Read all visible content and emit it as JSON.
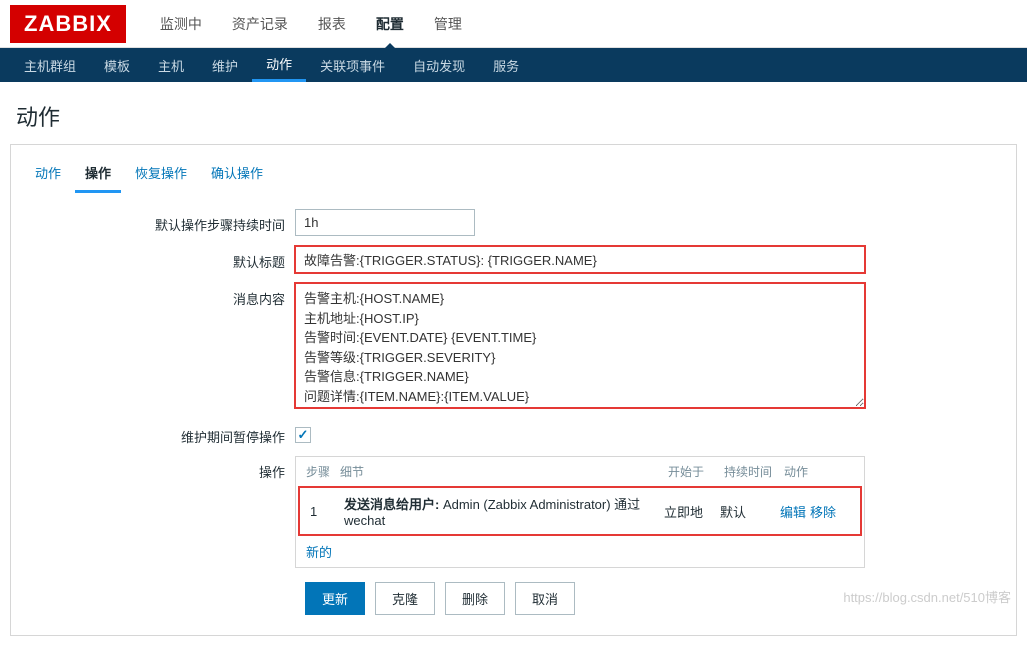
{
  "logo": "ZABBIX",
  "topNav": {
    "items": [
      "监测中",
      "资产记录",
      "报表",
      "配置",
      "管理"
    ],
    "activeIndex": 3
  },
  "subNav": {
    "items": [
      "主机群组",
      "模板",
      "主机",
      "维护",
      "动作",
      "关联项事件",
      "自动发现",
      "服务"
    ],
    "activeIndex": 4
  },
  "pageTitle": "动作",
  "innerTabs": {
    "items": [
      "动作",
      "操作",
      "恢复操作",
      "确认操作"
    ],
    "activeIndex": 1
  },
  "form": {
    "durationLabel": "默认操作步骤持续时间",
    "durationValue": "1h",
    "titleLabel": "默认标题",
    "titleValue": "故障告警:{TRIGGER.STATUS}: {TRIGGER.NAME}",
    "messageLabel": "消息内容",
    "messageValue": "告警主机:{HOST.NAME}\n主机地址:{HOST.IP}\n告警时间:{EVENT.DATE} {EVENT.TIME}\n告警等级:{TRIGGER.SEVERITY}\n告警信息:{TRIGGER.NAME}\n问题详情:{ITEM.NAME}:{ITEM.VALUE}",
    "pauseLabel": "维护期间暂停操作",
    "pauseChecked": true,
    "opsLabel": "操作"
  },
  "opsTable": {
    "headers": {
      "step": "步骤",
      "detail": "细节",
      "start": "开始于",
      "duration": "持续时间",
      "action": "动作"
    },
    "row": {
      "step": "1",
      "prefix": "发送消息给用户:",
      "detail": " Admin (Zabbix Administrator) 通过 wechat",
      "start": "立即地",
      "duration": "默认",
      "edit": "编辑",
      "remove": "移除"
    },
    "newLabel": "新的"
  },
  "buttons": {
    "update": "更新",
    "clone": "克隆",
    "delete": "删除",
    "cancel": "取消"
  },
  "watermark": "https://blog.csdn.net/510博客"
}
